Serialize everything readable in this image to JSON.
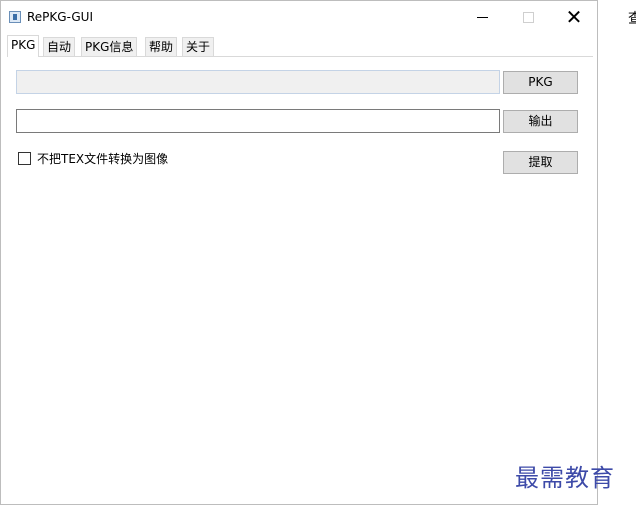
{
  "window": {
    "title": "RePKG-GUI",
    "controls": {
      "minimize": "—",
      "maximize": "□",
      "close": "✕"
    }
  },
  "tabs": [
    {
      "label": "PKG",
      "active": true
    },
    {
      "label": "自动",
      "active": false
    },
    {
      "label": "PKG信息",
      "active": false
    },
    {
      "label": "帮助",
      "active": false
    },
    {
      "label": "关于",
      "active": false
    }
  ],
  "pkg_panel": {
    "pkg_path": {
      "value": "",
      "placeholder": ""
    },
    "pkg_button": "PKG",
    "output_path": {
      "value": "",
      "placeholder": ""
    },
    "output_button": "输出",
    "checkbox_label": "不把TEX文件转换为图像",
    "checkbox_checked": false,
    "extract_button": "提取"
  },
  "background_text": "查",
  "watermark": "最需教育",
  "colors": {
    "watermark": "#3d4aa8",
    "button_bg": "#e1e1e1",
    "readonly_bg": "#f0f0f0"
  },
  "icons": {
    "app": "app-icon"
  }
}
